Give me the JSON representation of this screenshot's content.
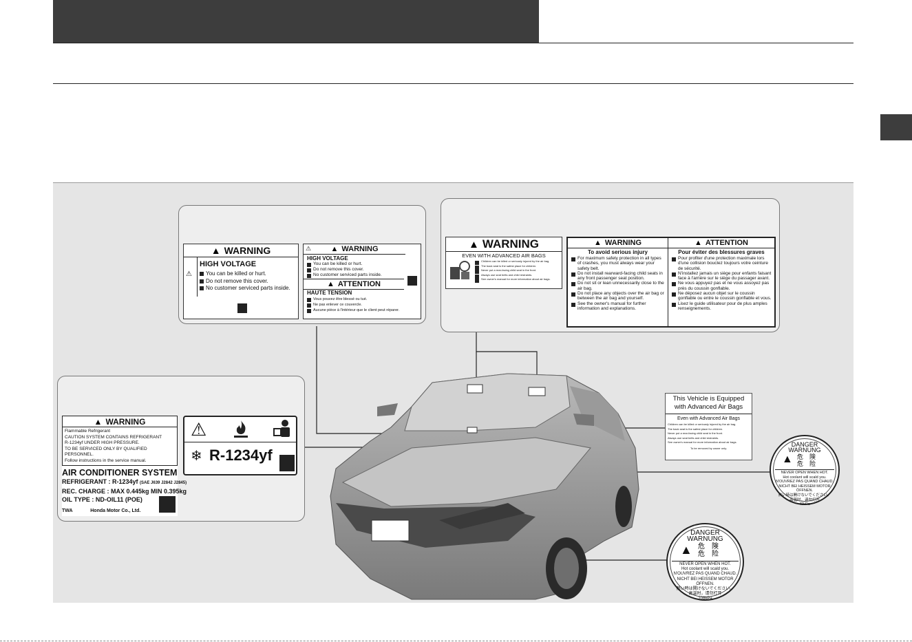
{
  "hv_labels": {
    "left": {
      "title": "WARNING",
      "heading": "HIGH VOLTAGE",
      "items": [
        "You can be killed or hurt.",
        "Do not remove this cover.",
        "No customer serviced parts inside."
      ]
    },
    "right": {
      "title": "WARNING",
      "heading": "HIGH VOLTAGE",
      "items": [
        "You can be killed or hurt.",
        "Do not remove this cover.",
        "No customer serviced parts inside."
      ],
      "attention": "ATTENTION",
      "fr_heading": "HAUTE TENSION",
      "fr_items": [
        "Vous pouvez être blessé ou tué.",
        "Ne pas enlever ce couvercle.",
        "Aucune pièce à l'intérieur que le client peut réparer."
      ]
    }
  },
  "airbag_label": {
    "title": "WARNING",
    "subtitle": "EVEN WITH ADVANCED AIR BAGS",
    "items": [
      "Children can be killed or seriously injured by the air bag.",
      "The back seat is the safest place for children.",
      "Never put a rear-facing child seat in the front.",
      "Always use seat belts and child restraints.",
      "See owner's manual for more information about air bags."
    ]
  },
  "airbag_bilingual": {
    "en_title": "WARNING",
    "en_heading": "To avoid serious injury",
    "en_items": [
      "For maximum safety protection in all types of crashes, you must always wear your safety belt.",
      "Do not install rearward-facing child seats in any front passenger seat position.",
      "Do not sit or lean unnecessarily close to the air bag.",
      "Do not place any objects over the air bag or between the air bag and yourself.",
      "See the owner's manual for further information and explanations."
    ],
    "fr_title": "ATTENTION",
    "fr_heading": "Pour éviter des blessures graves",
    "fr_items": [
      "Pour profiter d'une protection maximale lors d'une collision bouclez toujours votre ceinture de sécurité.",
      "N'installez jamais un siège pour enfants faisant face à l'arrière sur le siège du passager avant.",
      "Ne vous appuyez pas et ne vous assoyez pas près du coussin gonflable.",
      "Ne déposez aucun objet sur le coussin gonflable ou entre le coussin gonflable et vous.",
      "Lisez le guide utilisateur pour de plus amples renseignements."
    ]
  },
  "ac_label": {
    "title": "WARNING",
    "lines": [
      "Flammable Refrigerant",
      "CAUTION SYSTEM CONTAINS REFRIGERANT",
      "R-1234yf UNDER HIGH PRESSURE.",
      "TO BE SERVICED ONLY BY QUALIFIED PERSONNEL.",
      "Follow instructions in the service manual."
    ],
    "system": "AIR CONDITIONER SYSTEM",
    "refrigerant": "REFRIGERANT : R-1234yf",
    "refrigerant_note": "(SAE J639 J2842 J2845)",
    "charge": "REC. CHARGE : MAX 0.445kg  MIN 0.395kg",
    "oil": "OIL TYPE : ND-OIL11 (POE)",
    "code": "TWA",
    "maker": "Honda Motor Co., Ltd."
  },
  "refrigerant_icon_label": {
    "text": "R-1234yf"
  },
  "sun_visor_label": {
    "title": "This Vehicle is Equipped with Advanced Air Bags",
    "subtitle": "Even with Advanced Air Bags",
    "items": [
      "Children can be killed or seriously injured by the air bag.",
      "The back seat is the safest place for children.",
      "Never put a rear-facing child seat in the front.",
      "Always use seat belts and child restraints.",
      "See owner's manual for more information about air bags."
    ],
    "footer": "To be removed by owner only."
  },
  "radiator_cap_large": {
    "danger": "DANGER",
    "warnung": "WARNUNG",
    "kanji1": "危　険",
    "kanji2": "危　险",
    "lines": [
      "NEVER OPEN WHEN HOT.",
      "Hot coolant will scald you.",
      "N'OUVREZ PAS QUAND CHAUD.",
      "NICHT BEI HEISSEM MOTOR ÖFFNEN.",
      "熱い時は開けないでください。"
    ],
    "cn": "高温时，请勿打开",
    "pressure": "108kPa"
  },
  "radiator_cap_small": {
    "danger": "DANGER",
    "warnung": "WARNUNG",
    "kanji1": "危　険",
    "kanji2": "危　险",
    "lines": [
      "NEVER OPEN WHEN HOT.",
      "Hot coolant will scald you.",
      "N'OUVREZ PAS QUAND CHAUD.",
      "NICHT BEI HEISSEM MOTOR ÖFFNEN.",
      "熱い時は開けないでください。"
    ],
    "cn": "高温时，请勿打开",
    "pressure": "49kPa"
  }
}
